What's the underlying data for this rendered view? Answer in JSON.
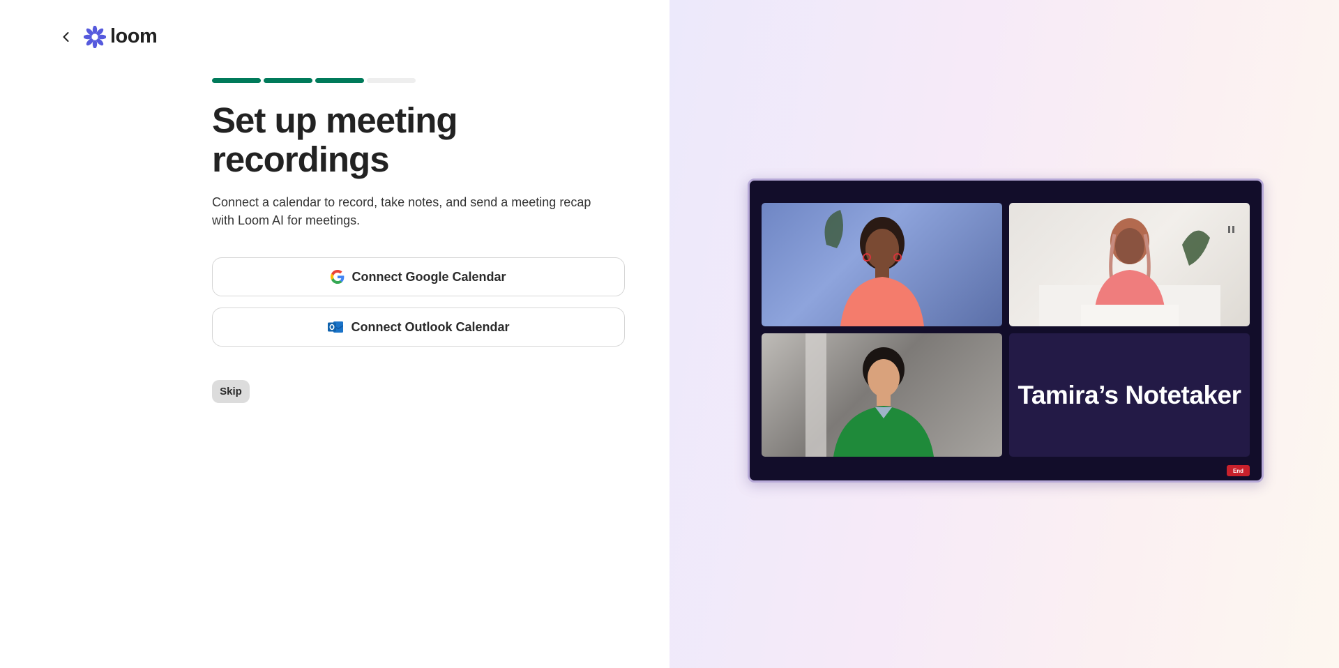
{
  "header": {
    "brand": "loom"
  },
  "progress": {
    "completed_steps": 3,
    "total_steps": 4
  },
  "main": {
    "title": "Set up meeting recordings",
    "description": "Connect a calendar to record, take notes, and send a meeting recap with Loom AI for meetings.",
    "google_button": "Connect Google Calendar",
    "outlook_button": "Connect Outlook Calendar",
    "skip_button": "Skip"
  },
  "preview": {
    "notetaker_label": "Tamira’s Notetaker",
    "end_button": "End"
  },
  "colors": {
    "progress_done": "#007a5a",
    "progress_todo": "#eeeeee",
    "loom_brand": "#565add",
    "meeting_bg": "#120d2a",
    "end_button": "#c8212c"
  },
  "icons": {
    "back": "chevron-left-icon",
    "logo": "loom-logo-icon",
    "google": "google-icon",
    "outlook": "outlook-icon"
  }
}
